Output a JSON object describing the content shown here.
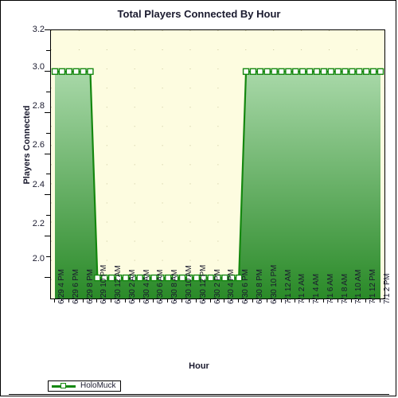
{
  "chart": {
    "title": "Total Players Connected By Hour",
    "xlabel": "Hour",
    "ylabel": "Players Connected"
  },
  "legend": {
    "series_label": "HoloMuck",
    "marker_icon": "square-marker-icon",
    "line_icon": "line-swatch-icon"
  },
  "colors": {
    "plot_background": "#fdfce0",
    "line": "#14870f",
    "fill_top": "#8ecb8e",
    "fill_bottom": "#2a8a28",
    "axis": "#000000",
    "text": "#1a1a2e",
    "marker_fill": "#ffffff"
  },
  "chart_data": {
    "type": "line",
    "title": "Total Players Connected By Hour",
    "xlabel": "Hour",
    "ylabel": "Players Connected",
    "ylim": [
      1.9,
      3.2
    ],
    "ytick_labels": [
      "3.2",
      "3.0",
      "2.8",
      "2.6",
      "2.4",
      "2.2",
      "2.0"
    ],
    "ytick_values": [
      3.2,
      3.0,
      2.8,
      2.6,
      2.4,
      2.2,
      2.0
    ],
    "grid": true,
    "legend_position": "bottom-left",
    "area_fill": true,
    "xtick_labels": [
      "6/29 4 PM",
      "6/29 6 PM",
      "6/29 8 PM",
      "6/29 10 PM",
      "6/30 12 AM",
      "6/30 2 AM",
      "6/30 4 AM",
      "6/30 6 AM",
      "6/30 8 AM",
      "6/30 10 AM",
      "6/30 12 PM",
      "6/30 2 PM",
      "6/30 4 PM",
      "6/30 6 PM",
      "6/30 8 PM",
      "6/30 10 PM",
      "7/1 12 AM",
      "7/1 2 AM",
      "7/1 4 AM",
      "7/1 6 AM",
      "7/1 8 AM",
      "7/1 10 AM",
      "7/1 12 PM",
      "7/1 2 PM"
    ],
    "series": [
      {
        "name": "HoloMuck",
        "x": [
          "6/29 4 PM",
          "6/29 5 PM",
          "6/29 6 PM",
          "6/29 7 PM",
          "6/29 8 PM",
          "6/29 9 PM",
          "6/29 10 PM",
          "6/29 11 PM",
          "6/30 12 AM",
          "6/30 1 AM",
          "6/30 2 AM",
          "6/30 3 AM",
          "6/30 4 AM",
          "6/30 5 AM",
          "6/30 6 AM",
          "6/30 7 AM",
          "6/30 8 AM",
          "6/30 9 AM",
          "6/30 10 AM",
          "6/30 11 AM",
          "6/30 12 PM",
          "6/30 1 PM",
          "6/30 2 PM",
          "6/30 3 PM",
          "6/30 4 PM",
          "6/30 5 PM",
          "6/30 6 PM",
          "6/30 7 PM",
          "6/30 8 PM",
          "6/30 9 PM",
          "6/30 10 PM",
          "6/30 11 PM",
          "7/1 12 AM",
          "7/1 1 AM",
          "7/1 2 AM",
          "7/1 3 AM",
          "7/1 4 AM",
          "7/1 5 AM",
          "7/1 6 AM",
          "7/1 7 AM",
          "7/1 8 AM",
          "7/1 9 AM",
          "7/1 10 AM",
          "7/1 11 AM",
          "7/1 12 PM",
          "7/1 1 PM",
          "7/1 2 PM"
        ],
        "values": [
          3,
          3,
          3,
          3,
          3,
          3,
          2,
          2,
          2,
          2,
          2,
          2,
          2,
          2,
          2,
          2,
          2,
          2,
          2,
          2,
          2,
          2,
          2,
          2,
          2,
          2,
          2,
          3,
          3,
          3,
          3,
          3,
          3,
          3,
          3,
          3,
          3,
          3,
          3,
          3,
          3,
          3,
          3,
          3,
          3,
          3,
          3
        ]
      }
    ]
  }
}
